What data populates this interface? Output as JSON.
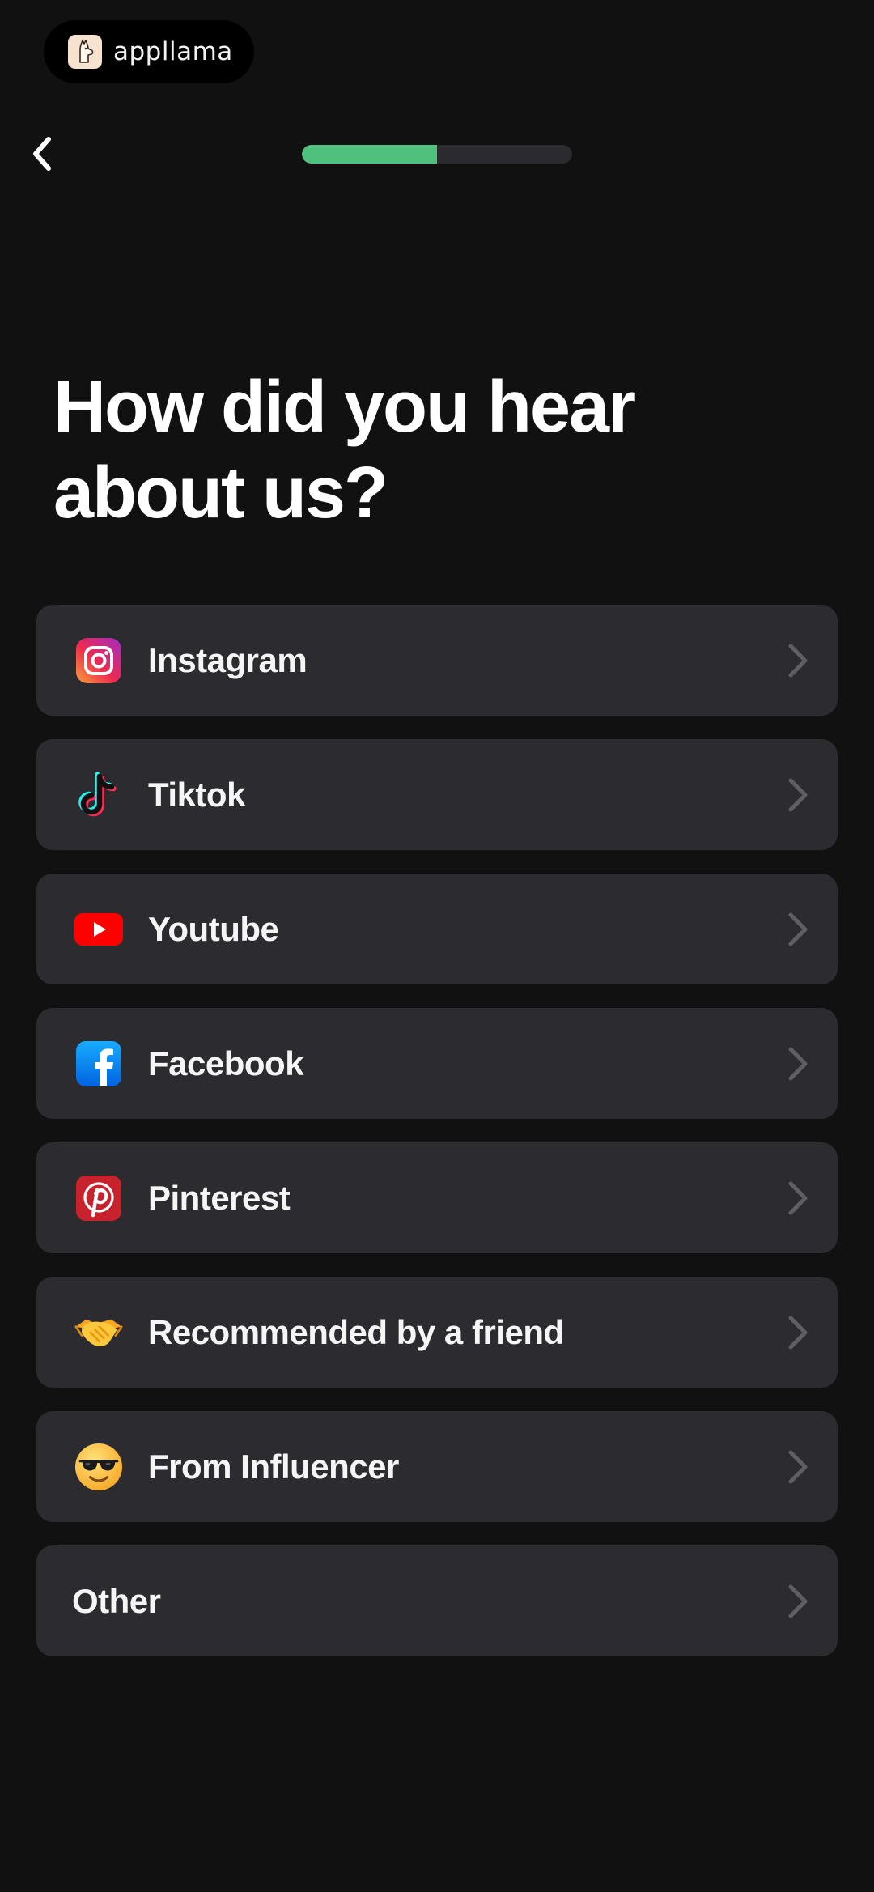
{
  "header": {
    "brand_name": "appllama",
    "brand_icon": "llama-icon",
    "back_icon": "chevron-left-icon",
    "progress": 0.5,
    "progress_color": "#4fc17c"
  },
  "title": {
    "line1": "How did you hear",
    "line2": "about us?"
  },
  "options": [
    {
      "label": "Instagram",
      "icon": "instagram-icon"
    },
    {
      "label": "Tiktok",
      "icon": "tiktok-icon"
    },
    {
      "label": "Youtube",
      "icon": "youtube-icon"
    },
    {
      "label": "Facebook",
      "icon": "facebook-icon"
    },
    {
      "label": "Pinterest",
      "icon": "pinterest-icon"
    },
    {
      "label": "Recommended by a friend",
      "icon": "handshake-emoji-icon"
    },
    {
      "label": "From Influencer",
      "icon": "sunglasses-face-emoji-icon"
    },
    {
      "label": "Other",
      "icon": ""
    }
  ],
  "colors": {
    "background": "#111112",
    "card": "#2c2c30",
    "accent": "#4fc17c",
    "track": "#2b2b2f"
  }
}
